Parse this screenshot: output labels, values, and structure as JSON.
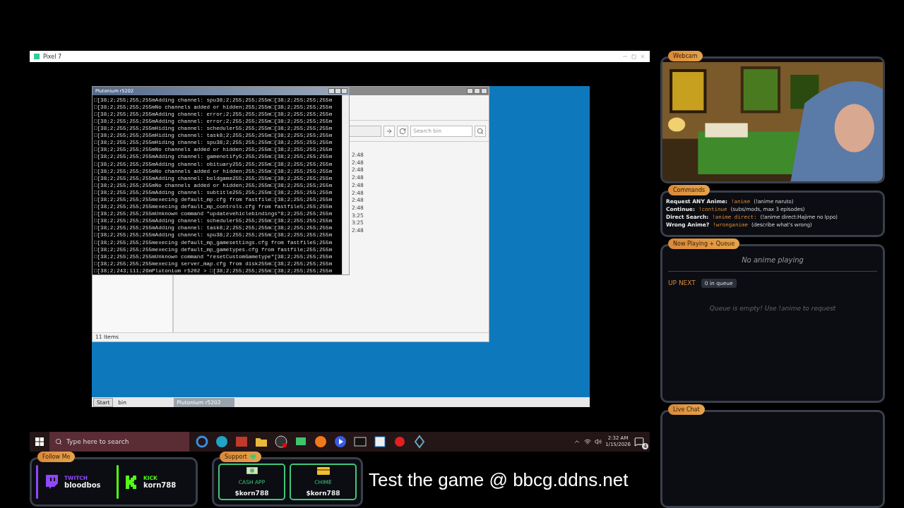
{
  "window": {
    "title": "Pixel 7"
  },
  "console": {
    "title": "Plutonium r5202",
    "lines": [
      "□[38;2;255;255;255mAdding channel: spu38;2;255;255;255m□[38;2;255;255;255m",
      "□[38;2;255;255;255mNo channels added or hidden;255;255m□[38;2;255;255;255m",
      "□[38;2;255;255;255mAdding channel: error;2;255;255;255m□[38;2;255;255;255m",
      "□[38;2;255;255;255mAdding channel: error;2;255;255;255m□[38;2;255;255;255m",
      "□[38;2;255;255;255mHiding channel: scheduler55;255;255m□[38;2;255;255;255m",
      "□[38;2;255;255;255mHiding channel: task8;2;255;255;255m□[38;2;255;255;255m",
      "□[38;2;255;255;255mHiding channel: spu38;2;255;255;255m□[38;2;255;255;255m",
      "□[38;2;255;255;255mNo channels added or hidden;255;255m□[38;2;255;255;255m",
      "□[38;2;255;255;255mAdding channel: gamenotify5;255;255m□[38;2;255;255;255m",
      "□[38;2;255;255;255mAdding channel: obituary255;255;255m□[38;2;255;255;255m",
      "□[38;2;255;255;255mNo channels added or hidden;255;255m□[38;2;255;255;255m",
      "□[38;2;255;255;255mAdding channel: boldgame255;255;255m□[38;2;255;255;255m",
      "□[38;2;255;255;255mNo channels added or hidden;255;255m□[38;2;255;255;255m",
      "□[38;2;255;255;255mAdding channel: subtitle255;255;255m□[38;2;255;255;255m",
      "□[38;2;255;255;255mexecing default_mp.cfg from fastfile□[38;2;255;255;255m",
      "□[38;2;255;255;255mexecing default_mp_controls.cfg from fastfile5;255;255m",
      "□[38;2;255;255;255mUnknown command \"updatevehiclebindings\"8;2;255;255;255m",
      "□[38;2;255;255;255mAdding channel: scheduler55;255;255m□[38;2;255;255;255m",
      "□[38;2;255;255;255mAdding channel: task8;2;255;255;255m□[38;2;255;255;255m",
      "□[38;2;255;255;255mAdding channel: spu38;2;255;255;255m□[38;2;255;255;255m",
      "□[38;2;255;255;255mexecing default_mp_gamesettings.cfg from fastfile5;255m",
      "□[38;2;255;255;255mexecing default_mp_gametypes.cfg from fastfile;255;255m",
      "□[38;2;255;255;255mUnknown command \"resetCustomGametype\"[38;2;255;255;255m",
      "□[38;2;255;255;255mexecing server_map.cfg from disk255m□[38;2;255;255;255m",
      "□[38;2;243;111;26mPlutonium r5202 > □[38;2;255;255;255m□[38;2;255;255;255m"
    ]
  },
  "explorer": {
    "search": {
      "placeholder": "Search bin"
    },
    "times": [
      "2:48",
      "2:48",
      "2:48",
      "2:48",
      "2:48",
      "2:48",
      "2:48",
      "2:48",
      "3:25",
      "3:25",
      "2:48"
    ],
    "status": "11 Items"
  },
  "guest_taskbar": {
    "start": "Start",
    "items": [
      {
        "label": "bin",
        "selected": false
      },
      {
        "label": "Plutonium r5202",
        "selected": true
      }
    ]
  },
  "taskbar": {
    "search": {
      "placeholder": "Type here to search"
    },
    "time": "2:32 AM",
    "date": "1/15/2026",
    "notifications": "4"
  },
  "follow": {
    "title": "Follow Me",
    "accounts": [
      {
        "kind": "twitch",
        "platform": "TWITCH",
        "handle": "bloodbos",
        "color": "#9146ff"
      },
      {
        "kind": "kick",
        "platform": "KICK",
        "handle": "korn788",
        "color": "#53fc18"
      }
    ]
  },
  "support": {
    "title": "Support",
    "methods": [
      {
        "kind": "cash",
        "label": "CASH APP",
        "handle": "$korn788"
      },
      {
        "kind": "card",
        "label": "CHIME",
        "handle": "$korn788"
      }
    ]
  },
  "banner": "Test the game @ bbcg.ddns.net",
  "webcam": {
    "title": "Webcam"
  },
  "commands": {
    "title": "Commands",
    "items": [
      {
        "label": "Request ANY Anime:",
        "command": "!anime",
        "note": "(!anime naruto)"
      },
      {
        "label": "Continue:",
        "command": "!continue",
        "note": "(subs/mods, max 3 episodes)"
      },
      {
        "label": "Direct Search:",
        "command": "!anime direct:",
        "note": "(!anime direct:Hajime no Ippo)"
      },
      {
        "label": "Wrong Anime?",
        "command": "!wronganime",
        "note": "(describe what's wrong)"
      }
    ]
  },
  "queue": {
    "title": "Now Playing + Queue",
    "now_playing": "No anime playing",
    "up_next": "UP NEXT",
    "count": "0 in queue",
    "empty": "Queue is empty! Use !anime to request"
  },
  "chat": {
    "title": "Live Chat"
  }
}
